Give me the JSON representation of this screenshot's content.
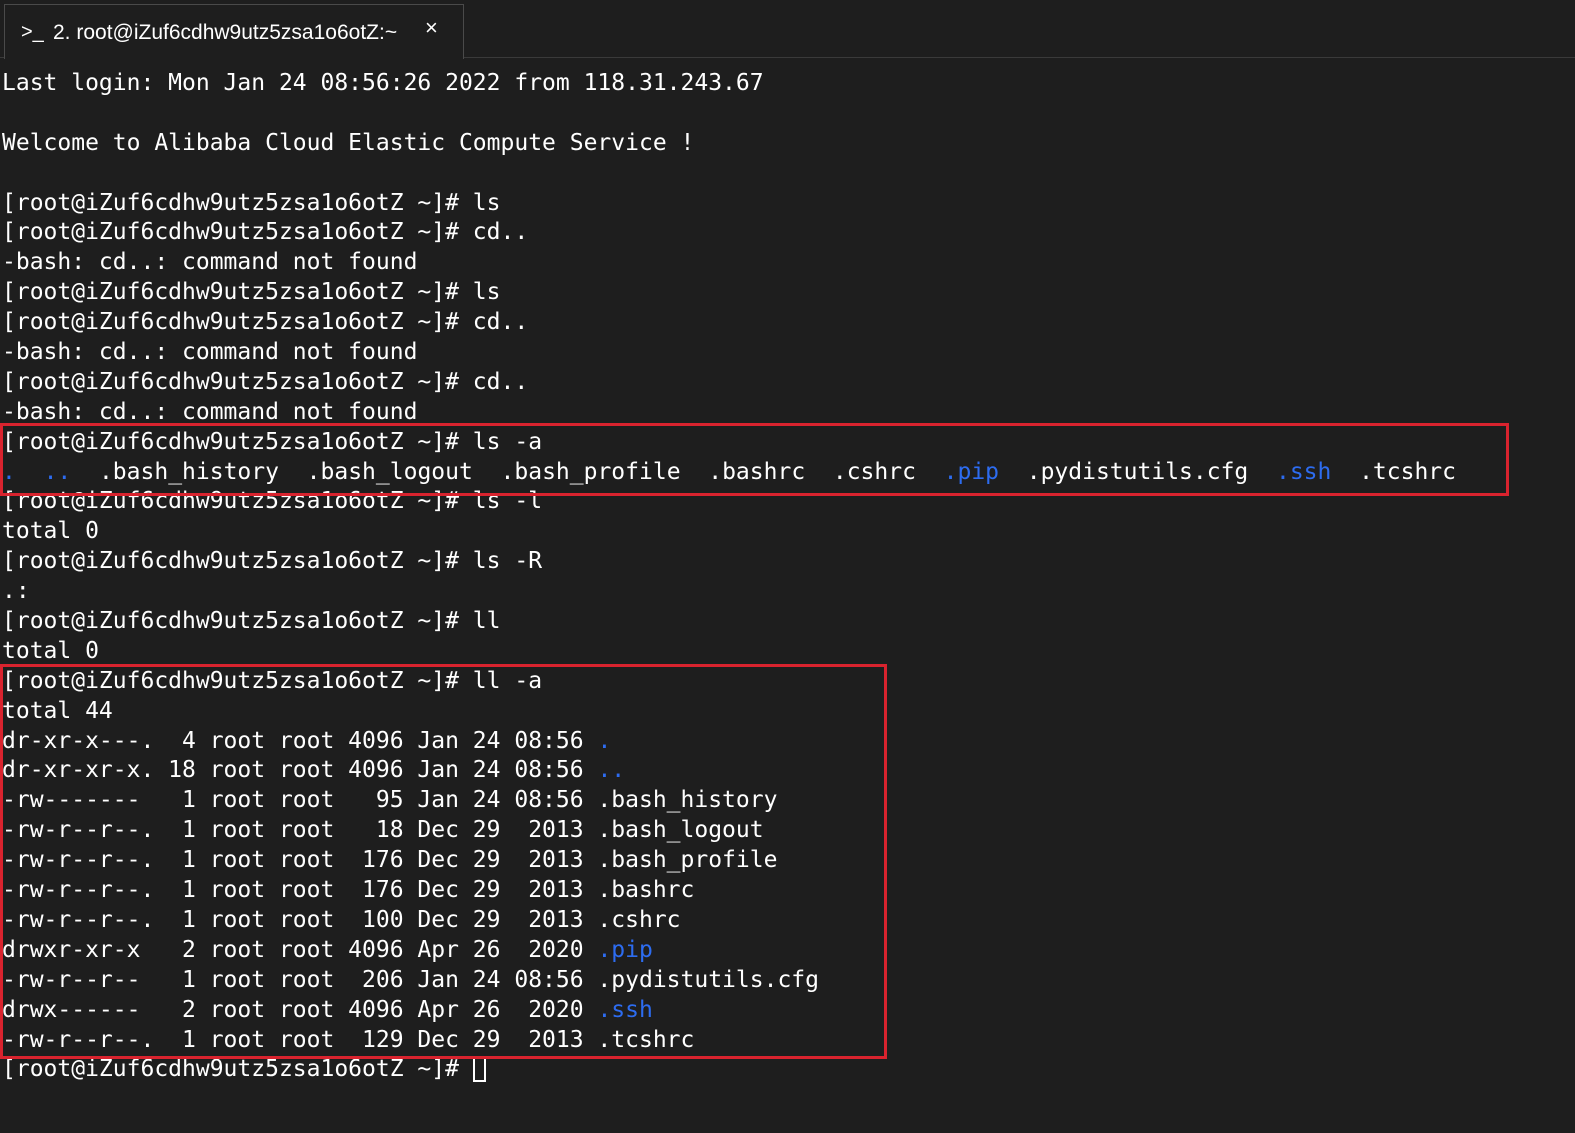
{
  "tab": {
    "icon": ">_",
    "title": "2. root@iZuf6cdhw9utz5zsa1o6otZ:~",
    "close": "×"
  },
  "colors": {
    "background": "#1e1e1e",
    "text": "#ffffff",
    "directory": "#2d6cf0",
    "highlight_box": "#d9232e"
  },
  "terminal": {
    "lines": [
      [
        {
          "t": "Last login: Mon Jan 24 08:56:26 2022 from 118.31.243.67"
        }
      ],
      [
        {
          "t": ""
        }
      ],
      [
        {
          "t": "Welcome to Alibaba Cloud Elastic Compute Service !"
        }
      ],
      [
        {
          "t": ""
        }
      ],
      [
        {
          "t": "[root@iZuf6cdhw9utz5zsa1o6otZ ~]# ls"
        }
      ],
      [
        {
          "t": "[root@iZuf6cdhw9utz5zsa1o6otZ ~]# cd.."
        }
      ],
      [
        {
          "t": "-bash: cd..: command not found"
        }
      ],
      [
        {
          "t": "[root@iZuf6cdhw9utz5zsa1o6otZ ~]# ls"
        }
      ],
      [
        {
          "t": "[root@iZuf6cdhw9utz5zsa1o6otZ ~]# cd.."
        }
      ],
      [
        {
          "t": "-bash: cd..: command not found"
        }
      ],
      [
        {
          "t": "[root@iZuf6cdhw9utz5zsa1o6otZ ~]# cd.."
        }
      ],
      [
        {
          "t": "-bash: cd..: command not found"
        }
      ],
      [
        {
          "t": "[root@iZuf6cdhw9utz5zsa1o6otZ ~]# ls -a"
        }
      ],
      [
        {
          "t": ".",
          "c": "dir"
        },
        {
          "t": "  "
        },
        {
          "t": "..",
          "c": "dir"
        },
        {
          "t": "  .bash_history  .bash_logout  .bash_profile  .bashrc  .cshrc  "
        },
        {
          "t": ".pip",
          "c": "dir"
        },
        {
          "t": "  .pydistutils.cfg  "
        },
        {
          "t": ".ssh",
          "c": "dir"
        },
        {
          "t": "  .tcshrc"
        }
      ],
      [
        {
          "t": "[root@iZuf6cdhw9utz5zsa1o6otZ ~]# ls -l"
        }
      ],
      [
        {
          "t": "total 0"
        }
      ],
      [
        {
          "t": "[root@iZuf6cdhw9utz5zsa1o6otZ ~]# ls -R"
        }
      ],
      [
        {
          "t": ".:"
        }
      ],
      [
        {
          "t": "[root@iZuf6cdhw9utz5zsa1o6otZ ~]# ll"
        }
      ],
      [
        {
          "t": "total 0"
        }
      ],
      [
        {
          "t": "[root@iZuf6cdhw9utz5zsa1o6otZ ~]# ll -a"
        }
      ],
      [
        {
          "t": "total 44"
        }
      ],
      [
        {
          "t": "dr-xr-x---.  4 root root 4096 Jan 24 08:56 "
        },
        {
          "t": ".",
          "c": "dir"
        }
      ],
      [
        {
          "t": "dr-xr-xr-x. 18 root root 4096 Jan 24 08:56 "
        },
        {
          "t": "..",
          "c": "dir"
        }
      ],
      [
        {
          "t": "-rw-------   1 root root   95 Jan 24 08:56 .bash_history"
        }
      ],
      [
        {
          "t": "-rw-r--r--.  1 root root   18 Dec 29  2013 .bash_logout"
        }
      ],
      [
        {
          "t": "-rw-r--r--.  1 root root  176 Dec 29  2013 .bash_profile"
        }
      ],
      [
        {
          "t": "-rw-r--r--.  1 root root  176 Dec 29  2013 .bashrc"
        }
      ],
      [
        {
          "t": "-rw-r--r--.  1 root root  100 Dec 29  2013 .cshrc"
        }
      ],
      [
        {
          "t": "drwxr-xr-x   2 root root 4096 Apr 26  2020 "
        },
        {
          "t": ".pip",
          "c": "dir"
        }
      ],
      [
        {
          "t": "-rw-r--r--   1 root root  206 Jan 24 08:56 .pydistutils.cfg"
        }
      ],
      [
        {
          "t": "drwx------   2 root root 4096 Apr 26  2020 "
        },
        {
          "t": ".ssh",
          "c": "dir"
        }
      ],
      [
        {
          "t": "-rw-r--r--.  1 root root  129 Dec 29  2013 .tcshrc"
        }
      ],
      [
        {
          "t": "[root@iZuf6cdhw9utz5zsa1o6otZ ~]# "
        },
        {
          "t": "",
          "c": "cursor"
        }
      ]
    ]
  }
}
